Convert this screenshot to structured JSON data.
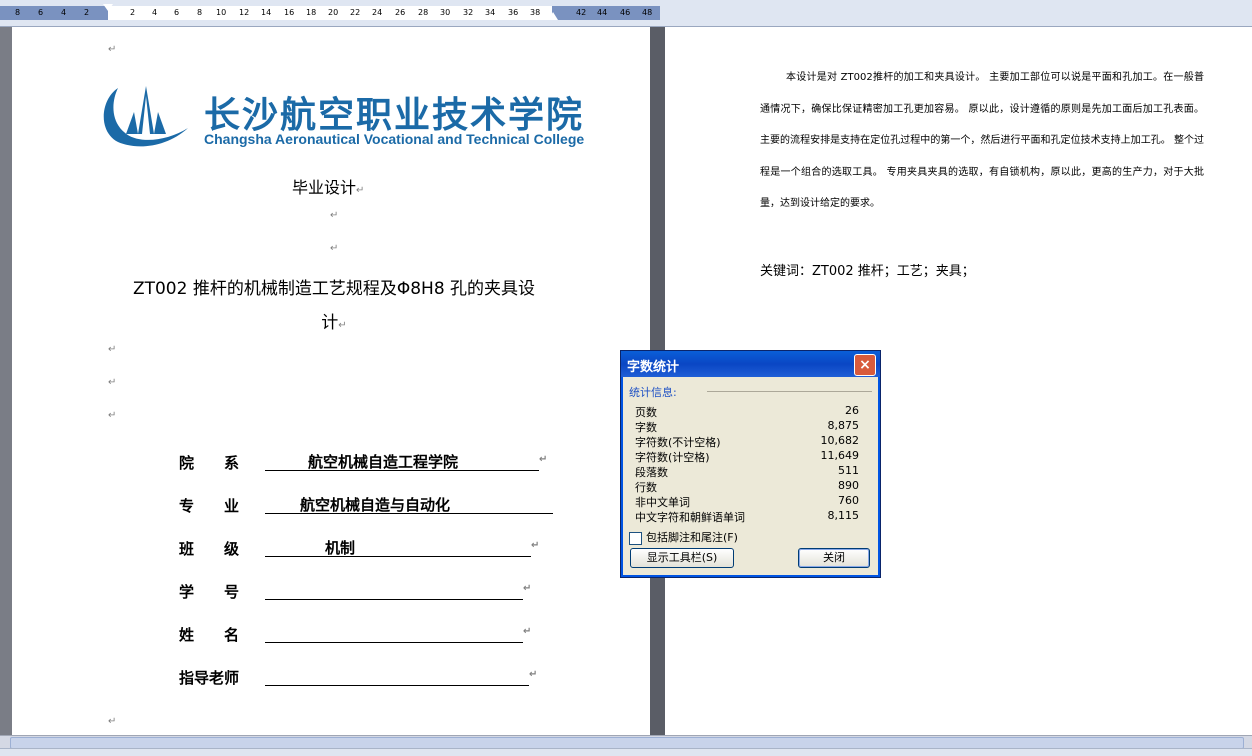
{
  "ruler": {
    "numbers": [
      "8",
      "6",
      "4",
      "2",
      "2",
      "4",
      "6",
      "8",
      "10",
      "12",
      "14",
      "16",
      "18",
      "20",
      "22",
      "24",
      "26",
      "28",
      "30",
      "32",
      "34",
      "36",
      "38",
      "42",
      "44",
      "46",
      "48"
    ]
  },
  "left_page": {
    "logo_cn": "长沙航空职业技术学院",
    "logo_en": "Changsha Aeronautical Vocational and Technical College",
    "heading": "毕业设计",
    "title_line1": "ZT002 推杆的机械制造工艺规程及Φ8H8 孔的夹具设",
    "title_line2": "计",
    "para_mark": "↵",
    "fields": [
      {
        "label": "院　　系",
        "value": "航空机械自造工程学院"
      },
      {
        "label": "专　　业",
        "value": "航空机械自造与自动化"
      },
      {
        "label": "班　　级",
        "value": "机制"
      },
      {
        "label": "学　　号",
        "value": ""
      },
      {
        "label": "姓　　名",
        "value": ""
      },
      {
        "label": "指导老师",
        "value": ""
      }
    ]
  },
  "right_page": {
    "abstract": "本设计是对 ZT002推杆的加工和夹具设计。 主要加工部位可以说是平面和孔加工。在一般普通情况下，确保比保证精密加工孔更加容易。 原以此，设计遵循的原则是先加工面后加工孔表面。 主要的流程安排是支持在定位孔过程中的第一个，然后进行平面和孔定位技术支持上加工孔。 整个过程是一个组合的选取工具。 专用夹具夹具的选取，有自锁机构，原以此，更高的生产力，对于大批量，达到设计给定的要求。",
    "keywords": "关键词：ZT002 推杆；工艺；夹具；"
  },
  "dialog": {
    "title": "字数统计",
    "section_label": "统计信息:",
    "stats": [
      {
        "label": "页数",
        "value": "26"
      },
      {
        "label": "字数",
        "value": "8,875"
      },
      {
        "label": "字符数(不计空格)",
        "value": "10,682"
      },
      {
        "label": "字符数(计空格)",
        "value": "11,649"
      },
      {
        "label": "段落数",
        "value": "511"
      },
      {
        "label": "行数",
        "value": "890"
      },
      {
        "label": "非中文单词",
        "value": "760"
      },
      {
        "label": "中文字符和朝鲜语单词",
        "value": "8,115"
      }
    ],
    "checkbox_label": "包括脚注和尾注(F)",
    "toolbar_button": "显示工具栏(S)",
    "close_button": "关闭",
    "close_icon": "×"
  },
  "colors": {
    "logo_blue": "#1b6aa7",
    "titlebar_blue": "#0a46c4"
  }
}
